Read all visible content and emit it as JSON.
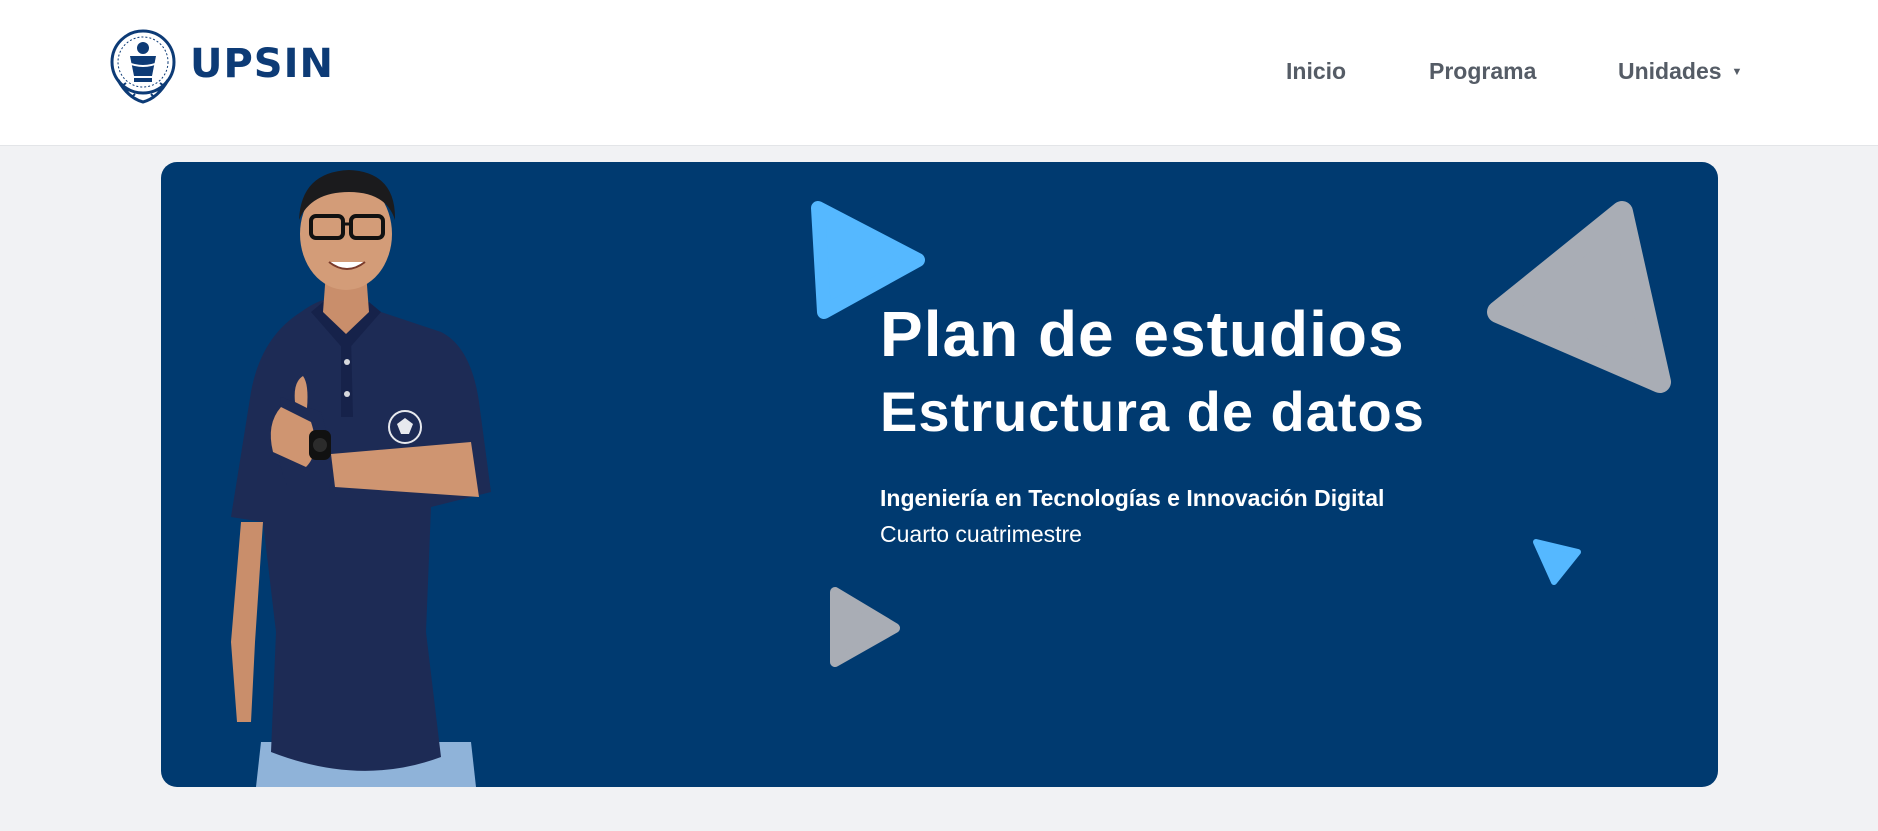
{
  "header": {
    "brand": "UPSIN",
    "nav": {
      "inicio": "Inicio",
      "programa": "Programa",
      "unidades": "Unidades"
    }
  },
  "hero": {
    "title": "Plan de estudios",
    "subtitle": "Estructura de datos",
    "program": "Ingeniería en Tecnologías e Innovación Digital",
    "term": "Cuarto cuatrimestre"
  },
  "colors": {
    "brand_blue": "#0d3b76",
    "hero_bg": "#003a70",
    "accent_light_blue": "#55b8ff",
    "accent_gray": "#a9adb5",
    "nav_text": "#555c66",
    "page_bg": "#f1f2f4"
  },
  "icons": {
    "logo": "university-seal-icon",
    "dropdown": "caret-down-icon"
  }
}
